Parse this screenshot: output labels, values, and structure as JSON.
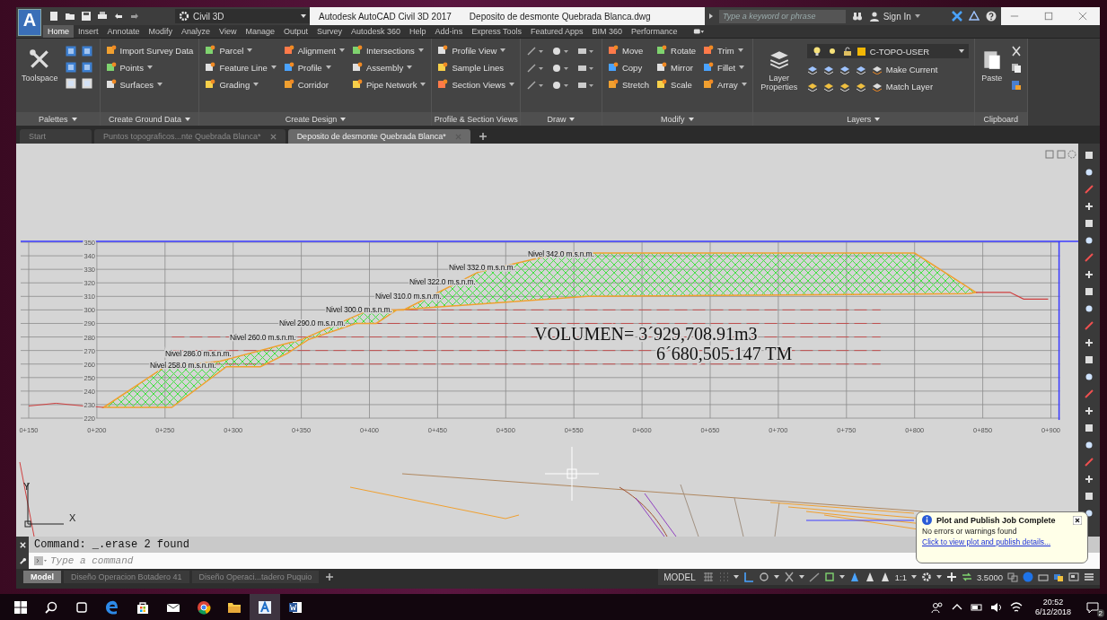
{
  "title_bar": {
    "app_logo": "A",
    "workspace": "Civil 3D",
    "app_title": "Autodesk AutoCAD Civil 3D 2017",
    "file_name": "Deposito de desmonte Quebrada Blanca.dwg",
    "search": {
      "placeholder": "Type a keyword or phrase"
    },
    "sign_in": "Sign In"
  },
  "ribbon_tabs": [
    {
      "label": "Home",
      "selected": true
    },
    {
      "label": "Insert",
      "selected": false
    },
    {
      "label": "Annotate",
      "selected": false
    },
    {
      "label": "Modify",
      "selected": false
    },
    {
      "label": "Analyze",
      "selected": false
    },
    {
      "label": "View",
      "selected": false
    },
    {
      "label": "Manage",
      "selected": false
    },
    {
      "label": "Output",
      "selected": false
    },
    {
      "label": "Survey",
      "selected": false
    },
    {
      "label": "Autodesk 360",
      "selected": false
    },
    {
      "label": "Help",
      "selected": false
    },
    {
      "label": "Add-ins",
      "selected": false
    },
    {
      "label": "Express Tools",
      "selected": false
    },
    {
      "label": "Featured Apps",
      "selected": false
    },
    {
      "label": "BIM 360",
      "selected": false
    },
    {
      "label": "Performance",
      "selected": false
    }
  ],
  "ribbon_panels": [
    {
      "kind": "palettes",
      "title": "Palettes",
      "menu": true,
      "large_button": "Toolspace"
    },
    {
      "kind": "buttons",
      "title": "Create Ground Data",
      "menu": true,
      "columns": [
        [
          {
            "label": "Import Survey Data",
            "dropdown": false
          },
          {
            "label": "Points",
            "dropdown": true
          },
          {
            "label": "Surfaces",
            "dropdown": true
          }
        ]
      ]
    },
    {
      "kind": "buttons",
      "title": "Create Design",
      "menu": true,
      "columns": [
        [
          {
            "label": "Parcel",
            "dropdown": true
          },
          {
            "label": "Feature Line",
            "dropdown": true
          },
          {
            "label": "Grading",
            "dropdown": true
          }
        ],
        [
          {
            "label": "Alignment",
            "dropdown": true
          },
          {
            "label": "Profile",
            "dropdown": true
          },
          {
            "label": "Corridor",
            "dropdown": false
          }
        ],
        [
          {
            "label": "Intersections",
            "dropdown": true
          },
          {
            "label": "Assembly",
            "dropdown": true
          },
          {
            "label": "Pipe Network",
            "dropdown": true
          }
        ]
      ]
    },
    {
      "kind": "buttons",
      "title": "Profile & Section Views",
      "menu": false,
      "columns": [
        [
          {
            "label": "Profile View",
            "dropdown": true
          },
          {
            "label": "Sample Lines",
            "dropdown": false
          },
          {
            "label": "Section Views",
            "dropdown": true
          }
        ]
      ]
    },
    {
      "kind": "draw",
      "title": "Draw",
      "menu": true
    },
    {
      "kind": "buttons",
      "title": "Modify",
      "menu": true,
      "columns": [
        [
          {
            "label": "Move",
            "dropdown": false
          },
          {
            "label": "Copy",
            "dropdown": false
          },
          {
            "label": "Stretch",
            "dropdown": false
          }
        ],
        [
          {
            "label": "Rotate",
            "dropdown": false
          },
          {
            "label": "Mirror",
            "dropdown": false
          },
          {
            "label": "Scale",
            "dropdown": false
          }
        ],
        [
          {
            "label": "Trim",
            "dropdown": true
          },
          {
            "label": "Fillet",
            "dropdown": true
          },
          {
            "label": "Array",
            "dropdown": true
          }
        ]
      ]
    },
    {
      "kind": "layers",
      "title": "Layers",
      "menu": true,
      "large_button": "Layer Properties",
      "layer": {
        "name": "C-TOPO-USER",
        "color": "#f2b705"
      },
      "actions": [
        "Make Current",
        "Match Layer"
      ]
    },
    {
      "kind": "clipboard",
      "title": "Clipboard",
      "menu": false,
      "large_button": "Paste"
    }
  ],
  "document_tabs": [
    {
      "label": "Start",
      "selected": false
    },
    {
      "label": "Puntos topograficos...nte Quebrada Blanca*",
      "selected": false
    },
    {
      "label": "Deposito de desmonte Quebrada Blanca*",
      "selected": true
    }
  ],
  "drawing": {
    "elevations": [
      "350",
      "340",
      "330",
      "320",
      "310",
      "300",
      "290",
      "280",
      "270",
      "260",
      "250",
      "240",
      "230",
      "220"
    ],
    "stations": [
      "0+150",
      "0+200",
      "0+250",
      "0+300",
      "0+350",
      "0+400",
      "0+450",
      "0+500",
      "0+550",
      "0+600",
      "0+650",
      "0+700",
      "0+750",
      "0+800",
      "0+850",
      "0+900"
    ],
    "levels": [
      "Nivel 342.0 m.s.n.m.",
      "Nivel 332.0 m.s.n.m.",
      "Nivel 322.0 m.s.n.m.",
      "Nivel 310.0 m.s.n.m.",
      "Nivel 300.0 m.s.n.m.",
      "Nivel 290.0 m.s.n.m.",
      "Nivel 260.0 m.s.n.m.",
      "Nivel 286.0 m.s.n.m.",
      "Nivel 258.0 m.s.n.m."
    ],
    "volume": "VOLUMEN= 3´929,708.91m3",
    "tonnage": "6´680,505.147 TM",
    "ucs_y": "Y",
    "ucs_x": "X"
  },
  "command_line": {
    "history": "Command: _.erase 2 found",
    "placeholder": "Type a command"
  },
  "layout_tabs": [
    {
      "label": "Model",
      "selected": true
    },
    {
      "label": "Diseño Operacion Botadero 41",
      "selected": false
    },
    {
      "label": "Diseño Operaci...tadero Puquio",
      "selected": false
    }
  ],
  "status_bar": {
    "space": "MODEL",
    "annotation_scale": "1:1",
    "value": "3.5000"
  },
  "notification": {
    "title": "Plot and Publish Job Complete",
    "message": "No errors or warnings found",
    "link": "Click to view plot and publish details..."
  },
  "taskbar": {
    "apps": [
      {
        "kind": "start",
        "selected": false
      },
      {
        "kind": "search",
        "selected": false
      },
      {
        "kind": "task-view",
        "selected": false
      },
      {
        "kind": "edge",
        "selected": false
      },
      {
        "kind": "store",
        "selected": false
      },
      {
        "kind": "mail",
        "selected": false
      },
      {
        "kind": "chrome",
        "selected": false
      },
      {
        "kind": "folder",
        "selected": false
      },
      {
        "kind": "autocad",
        "selected": true
      },
      {
        "kind": "word",
        "selected": false
      }
    ],
    "time": "20:52",
    "date": "6/12/2018",
    "notifications": "2"
  }
}
